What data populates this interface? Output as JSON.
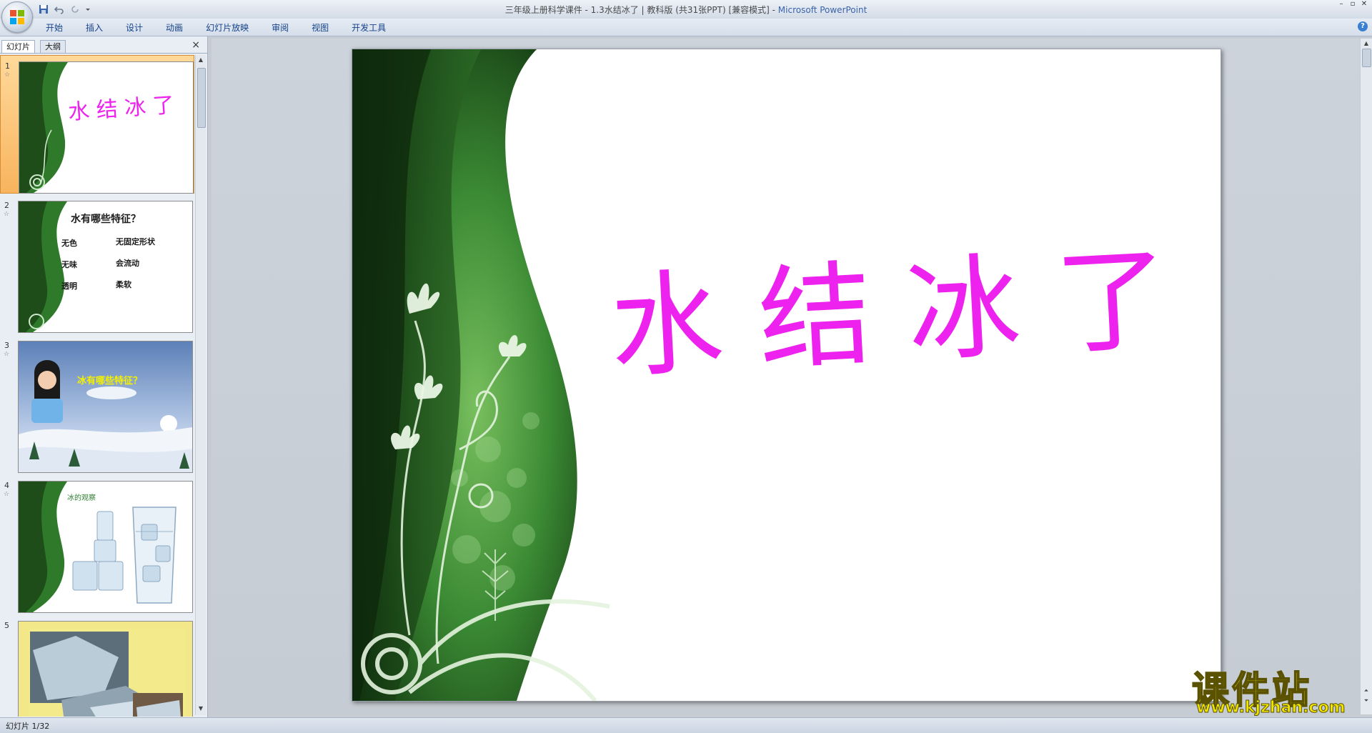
{
  "window": {
    "title_doc": "三年级上册科学课件 - 1.3水结冰了 | 教科版  (共31张PPT) [兼容模式] - ",
    "title_app": "Microsoft PowerPoint"
  },
  "ribbon": {
    "tabs": [
      "开始",
      "插入",
      "设计",
      "动画",
      "幻灯片放映",
      "审阅",
      "视图",
      "开发工具"
    ]
  },
  "panel": {
    "tab_slides": "幻灯片",
    "tab_outline": "大纲",
    "close": "×"
  },
  "thumbnails": [
    {
      "num": "1",
      "title": "水 结 冰 了"
    },
    {
      "num": "2",
      "title": "水有哪些特征？",
      "items": [
        "无色",
        "无固定形状",
        "无味",
        "会流动",
        "透明",
        "柔软"
      ]
    },
    {
      "num": "3",
      "title": "冰有哪些特征？"
    },
    {
      "num": "4",
      "title": "冰的观察"
    },
    {
      "num": "5"
    }
  ],
  "slide": {
    "title": "水结冰了"
  },
  "status": {
    "text": "幻灯片 1/32"
  },
  "watermark": {
    "cn": "课件站",
    "url": "www.kjzhan.com"
  },
  "colors": {
    "title_magenta": "#ee22ee",
    "green_dark": "#1e4d1a",
    "green_mid": "#3f8f38",
    "ribbon_text": "#15428b",
    "watermark_yellow": "#f2e600"
  }
}
